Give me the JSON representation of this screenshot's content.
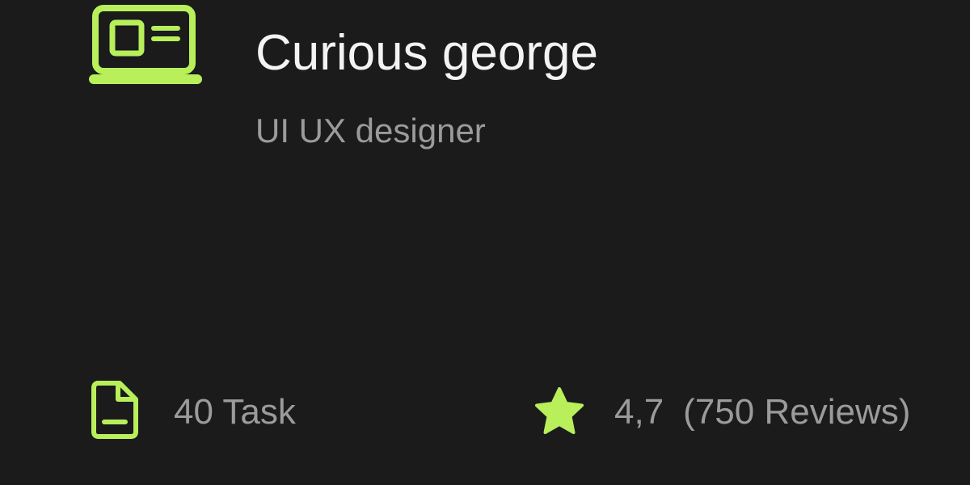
{
  "profile": {
    "icon": "laptop-icon",
    "name": "Curious george",
    "role": "UI UX designer"
  },
  "stats": {
    "tasks": {
      "icon": "document-icon",
      "label": "40 Task"
    },
    "rating": {
      "icon": "star-icon",
      "value": "4,7",
      "reviews": "(750 Reviews)"
    }
  },
  "colors": {
    "accent": "#b8ef5a",
    "background": "#1b1b1c",
    "primary_text": "#f3f3f3",
    "secondary_text": "#9b9b9b"
  }
}
